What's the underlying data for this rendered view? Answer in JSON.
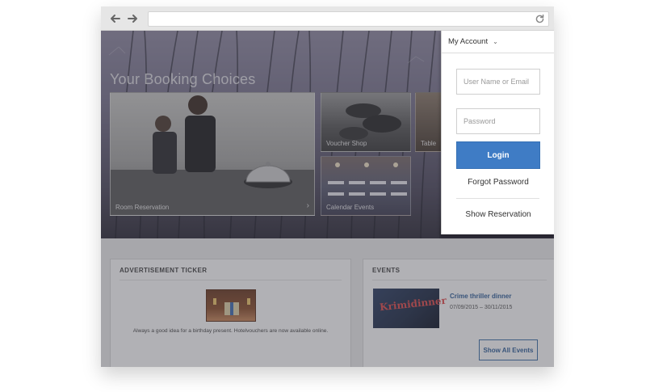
{
  "browser": {
    "back_icon": "arrow-left-icon",
    "forward_icon": "arrow-right-icon",
    "reload_icon": "reload-icon",
    "url": ""
  },
  "hero": {
    "title": "Your Booking Choices",
    "tiles": [
      {
        "label": "Room Reservation"
      },
      {
        "label": "Voucher Shop"
      },
      {
        "label": "Table"
      },
      {
        "label": "Calendar Events"
      }
    ]
  },
  "account": {
    "menu_label": "My Account",
    "username_placeholder": "User Name or Email",
    "password_placeholder": "Password",
    "login_label": "Login",
    "forgot_label": "Forgot Password",
    "show_reservation_label": "Show Reservation",
    "accent_color": "#3f7cc5"
  },
  "ad_ticker": {
    "heading": "ADVERTISEMENT TICKER",
    "text": "Always a good idea for a birthday present. Hotelvouchers are now available online."
  },
  "events": {
    "heading": "EVENTS",
    "item_title": "Crime thriller dinner",
    "item_dates": "07/09/2015 – 30/11/2015",
    "image_text": "Krimidinner",
    "show_all_label": "Show All Events"
  }
}
